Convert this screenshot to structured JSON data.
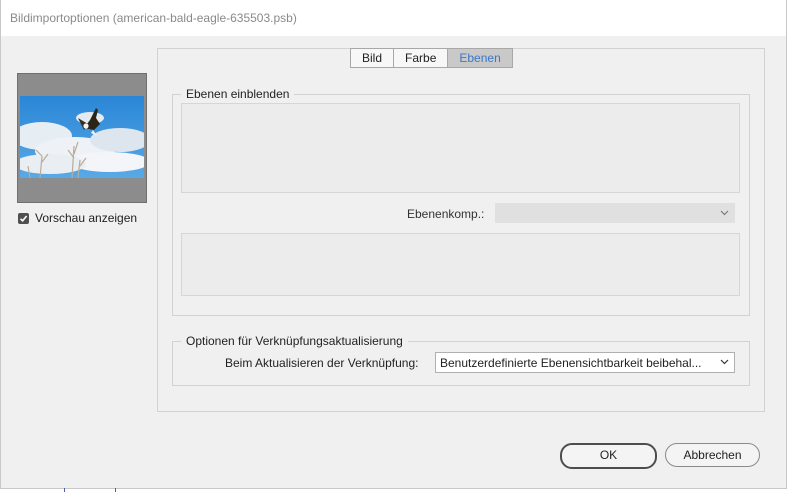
{
  "window": {
    "title": "Bildimportoptionen (american-bald-eagle-635503.psb)"
  },
  "preview": {
    "show_label": "Vorschau anzeigen",
    "checked": true
  },
  "tabs": [
    {
      "label": "Bild",
      "active": false
    },
    {
      "label": "Farbe",
      "active": false
    },
    {
      "label": "Ebenen",
      "active": true
    }
  ],
  "layers": {
    "group_label": "Ebenen einblenden",
    "komp_label": "Ebenenkomp.:"
  },
  "update": {
    "group_label": "Optionen für Verknüpfungsaktualisierung",
    "field_label": "Beim Aktualisieren der Verknüpfung:",
    "selected": "Benutzerdefinierte Ebenensichtbarkeit beibehal..."
  },
  "buttons": {
    "ok": "OK",
    "cancel": "Abbrechen"
  },
  "colors": {
    "active_tab_text": "#3a78c9",
    "dialog_bg": "#f0f0f0"
  }
}
